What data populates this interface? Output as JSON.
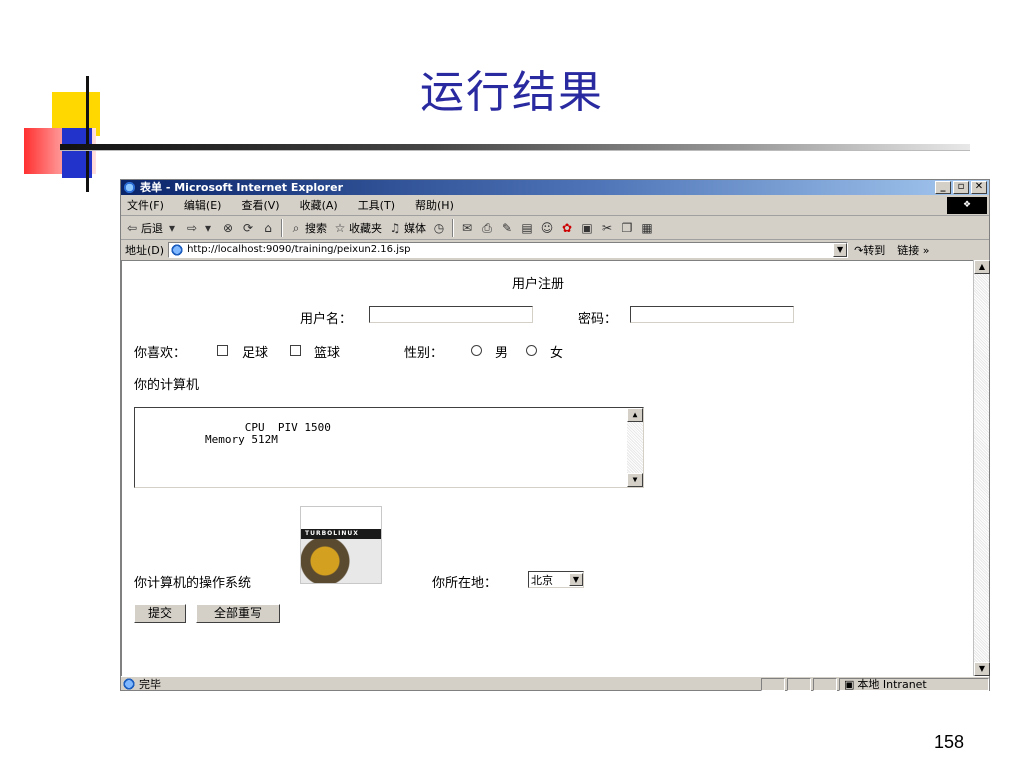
{
  "slide": {
    "title": "运行结果",
    "page_number": "158"
  },
  "window": {
    "title": "表单 - Microsoft Internet Explorer",
    "controls": [
      "_",
      "▫",
      "✕"
    ],
    "menu": [
      "文件(F)",
      "编辑(E)",
      "查看(V)",
      "收藏(A)",
      "工具(T)",
      "帮助(H)"
    ],
    "toolbar": {
      "back": "后退",
      "search": "搜索",
      "favorites": "收藏夹",
      "media": "媒体"
    },
    "address": {
      "label": "地址(D)",
      "url": "http://localhost:9090/training/peixun2.16.jsp",
      "go": "转到",
      "links": "链接"
    },
    "status": {
      "text": "完毕",
      "zone": "本地 Intranet"
    }
  },
  "form": {
    "heading": "用户注册",
    "username_label": "用户名：",
    "username_value": "",
    "password_label": "密码：",
    "password_value": "",
    "hobby_label": "你喜欢：",
    "hobbies": [
      "足球",
      "篮球"
    ],
    "gender_label": "性别：",
    "genders": [
      "男",
      "女"
    ],
    "computer_label": "你的计算机",
    "computer_text": "CPU  PIV 1500\nMemory 512M",
    "os_label": "你计算机的操作系统",
    "os_image_text": "TURBOLINUX",
    "location_label": "你所在地：",
    "location_value": "北京",
    "submit_label": "提交",
    "reset_label": "全部重写"
  }
}
